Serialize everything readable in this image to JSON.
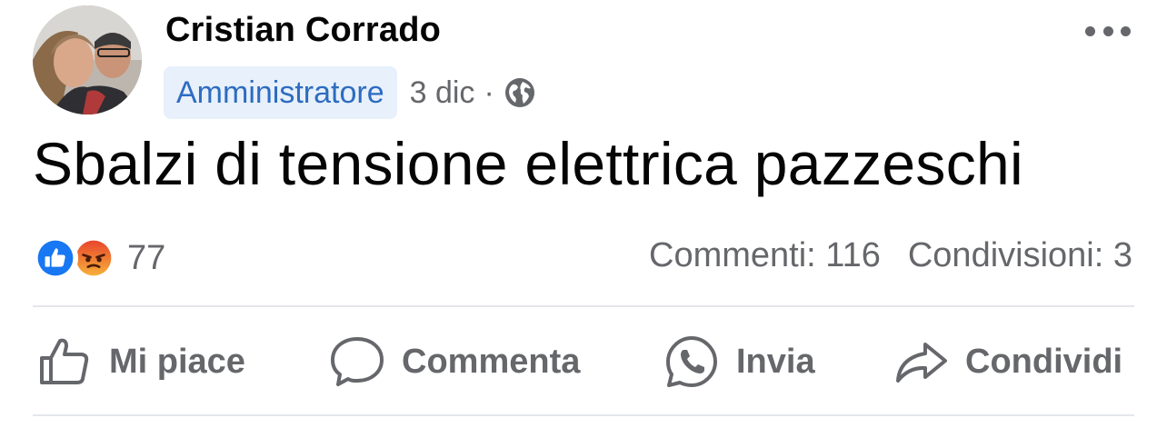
{
  "post": {
    "author": "Cristian Corrado",
    "role_badge": "Amministratore",
    "date": "3 dic",
    "separator": "·",
    "audience_icon": "globe-icon",
    "text": "Sbalzi di tensione elettrica pazzeschi"
  },
  "reactions": {
    "icons": [
      "like-reaction-icon",
      "angry-reaction-icon"
    ],
    "count": "77"
  },
  "stats": {
    "comments": "Commenti: 116",
    "shares": "Condivisioni: 3"
  },
  "actions": {
    "like_label": "Mi piace",
    "comment_label": "Commenta",
    "send_label": "Invia",
    "share_label": "Condividi"
  },
  "colors": {
    "text_primary": "#050505",
    "text_secondary": "#65676b",
    "badge_bg": "#e7f0fb",
    "badge_text": "#2d6cc0",
    "like_blue": "#1877f2",
    "angry_orange": "#f26b2a",
    "divider": "#e4e6eb"
  }
}
